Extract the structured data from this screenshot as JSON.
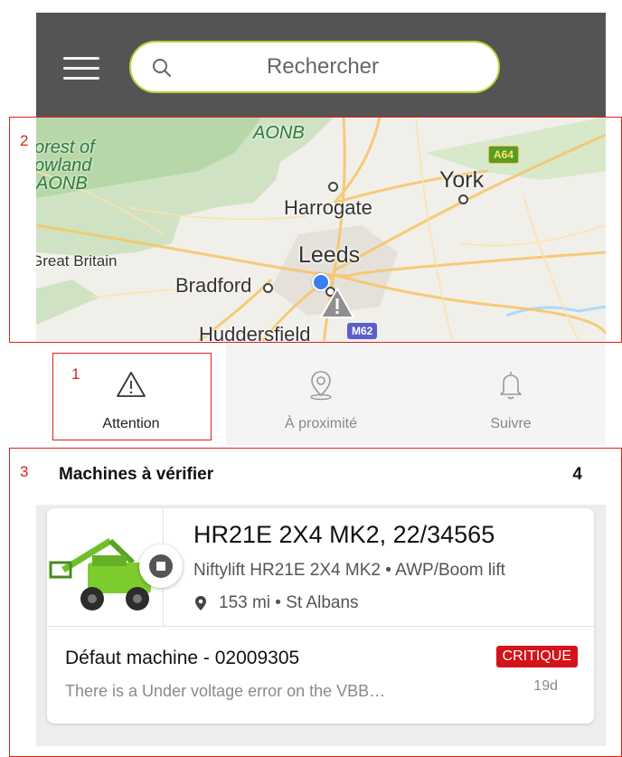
{
  "search": {
    "placeholder": "Rechercher"
  },
  "map": {
    "labels": {
      "aonb_top": "AONB",
      "forest_line1": "orest of",
      "forest_line2": "owland",
      "forest_line3": "AONB",
      "york": "York",
      "harrogate": "Harrogate",
      "great_britain": "Great Britain",
      "leeds": "Leeds",
      "bradford": "Bradford",
      "huddersfield": "Huddersfield"
    },
    "road_shields": {
      "a64": "A64",
      "m62": "M62"
    }
  },
  "tabs": [
    {
      "label": "Attention",
      "icon": "warning-icon",
      "active": true
    },
    {
      "label": "À proximité",
      "icon": "location-pin-icon",
      "active": false
    },
    {
      "label": "Suivre",
      "icon": "bell-icon",
      "active": false
    }
  ],
  "section": {
    "title": "Machines à vérifier",
    "count": "4"
  },
  "card": {
    "title": "HR21E 2X4 MK2, 22/34565",
    "description": "Niftylift HR21E 2X4 MK2 • AWP/Boom lift",
    "location": "153 mi • St Albans",
    "fault_title": "Défaut machine - 02009305",
    "badge": "CRITIQUE",
    "fault_text": "There is a Under voltage error on the VBB…",
    "age": "19d"
  },
  "annotations": [
    "1",
    "2",
    "3"
  ],
  "colors": {
    "header_bg": "#545454",
    "accent_green": "#b5d336",
    "critical_red": "#d4121a",
    "annotation_red": "#e0201a"
  }
}
